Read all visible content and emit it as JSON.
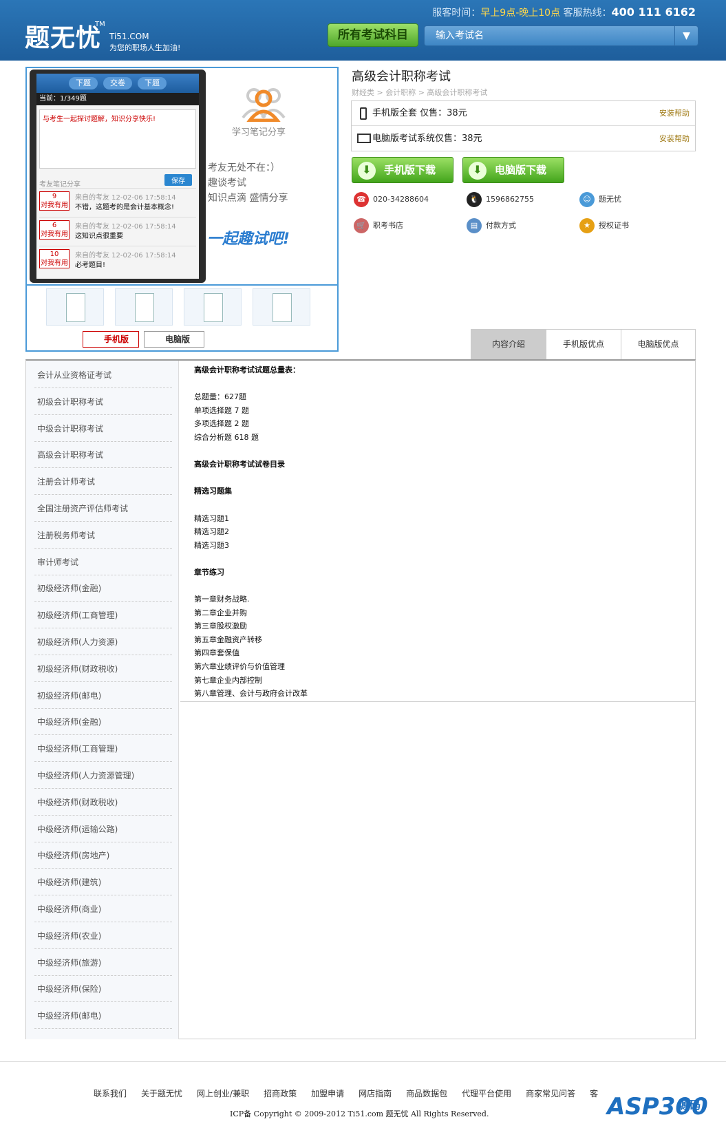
{
  "header": {
    "logo": "题无忧",
    "logo_tm": "TM",
    "domain": "Ti51.COM",
    "slogan": "为您的职场人生加油!",
    "service_label": "服客时间：",
    "service_hours": "早上9点-晚上10点",
    "hotline_label": "客服热线：",
    "hotline": "400 111 6162",
    "all_subjects": "所有考试科目",
    "search_placeholder": "输入考试名"
  },
  "gallery": {
    "phone_tabs": [
      "下题",
      "交卷",
      "下题"
    ],
    "phone_current": "当前：1/349题",
    "phone_note": "与考生一起探讨题解，知识分享快乐!",
    "phone_save": "保存",
    "phone_section": "考友笔记分享",
    "phone_rows": [
      {
        "num": "9",
        "tag": "对我有用",
        "meta": "来自的考友 12-02-06 17:58:14",
        "text": "不错，这题考的是会计基本概念!"
      },
      {
        "num": "6",
        "tag": "对我有用",
        "meta": "来自的考友 12-02-06 17:58:14",
        "text": "这知识点很重要"
      },
      {
        "num": "10",
        "tag": "对我有用",
        "meta": "来自的考友 12-02-06 17:58:14",
        "text": "必考题目!"
      }
    ],
    "promo_title": "学习笔记分享",
    "promo_lines": [
      "考友无处不在：）",
      "趣谈考试",
      "知识点滴 盛情分享"
    ],
    "promo_cta": "一起趣试吧!",
    "source_mobile": "手机版",
    "source_pc": "电脑版"
  },
  "product": {
    "title": "高级会计职称考试",
    "breadcrumb": "财经类 > 会计职称 > 高级会计职称考试",
    "price_mobile": "手机版全套  仅售：38元",
    "price_pc": "电脑版考试系统仅售：38元",
    "help": "安装帮助",
    "dl_mobile": "手机版下载",
    "dl_pc": "电脑版下载",
    "phone": "020-34288604",
    "qq": "1596862755",
    "brand": "题无忧",
    "bookstore": "职考书店",
    "payment": "付款方式",
    "cert": "授权证书"
  },
  "tabs": [
    "内容介绍",
    "手机版优点",
    "电脑版优点"
  ],
  "sidebar": [
    "会计从业资格证考试",
    "初级会计职称考试",
    "中级会计职称考试",
    "高级会计职称考试",
    "注册会计师考试",
    "全国注册资产评估师考试",
    "注册税务师考试",
    "审计师考试",
    "初级经济师(金融)",
    "初级经济师(工商管理)",
    "初级经济师(人力资源)",
    "初级经济师(财政税收)",
    "初级经济师(邮电)",
    "中级经济师(金融)",
    "中级经济师(工商管理)",
    "中级经济师(人力资源管理)",
    "中级经济师(财政税收)",
    "中级经济师(运输公路)",
    "中级经济师(房地产)",
    "中级经济师(建筑)",
    "中级经济师(商业)",
    "中级经济师(农业)",
    "中级经济师(旅游)",
    "中级经济师(保险)",
    "中级经济师(邮电)"
  ],
  "content": {
    "lines": [
      {
        "t": "高级会计职称考试试题总量表：",
        "b": true
      },
      {
        "t": "",
        "b": false
      },
      {
        "t": "总题量：627题",
        "b": false
      },
      {
        "t": "单项选择题 7 题",
        "b": false
      },
      {
        "t": "多项选择题 2 题",
        "b": false
      },
      {
        "t": "综合分析题 618 题",
        "b": false
      },
      {
        "t": "",
        "b": false
      },
      {
        "t": "高级会计职称考试试卷目录",
        "b": true
      },
      {
        "t": "",
        "b": false
      },
      {
        "t": "精选习题集",
        "b": true
      },
      {
        "t": "",
        "b": false
      },
      {
        "t": "精选习题1",
        "b": false
      },
      {
        "t": "精选习题2",
        "b": false
      },
      {
        "t": "精选习题3",
        "b": false
      },
      {
        "t": "",
        "b": false
      },
      {
        "t": "章节练习",
        "b": true
      },
      {
        "t": "",
        "b": false
      },
      {
        "t": "第一章财务战略.",
        "b": false
      },
      {
        "t": "第二章企业并购",
        "b": false
      },
      {
        "t": "第三章股权激励",
        "b": false
      },
      {
        "t": "第五章金融资产转移",
        "b": false
      },
      {
        "t": "第四章套保值",
        "b": false
      },
      {
        "t": "第六章业绩评价与价值管理",
        "b": false
      },
      {
        "t": "第七章企业内部控制",
        "b": false
      },
      {
        "t": "第八章管理、会计与政府会计改革",
        "b": false
      }
    ]
  },
  "footer": {
    "links": [
      "联系我们",
      "关于题无忧",
      "网上创业/兼职",
      "招商政策",
      "加盟申请",
      "网店指南",
      "商品数据包",
      "代理平台使用",
      "商家常见问答",
      "客"
    ],
    "copyright": "ICP备 Copyright © 2009-2012 Ti51.com 题无忧 All Rights Reserved.",
    "watermark": "ASP300",
    "watermark_sub": "源码"
  }
}
